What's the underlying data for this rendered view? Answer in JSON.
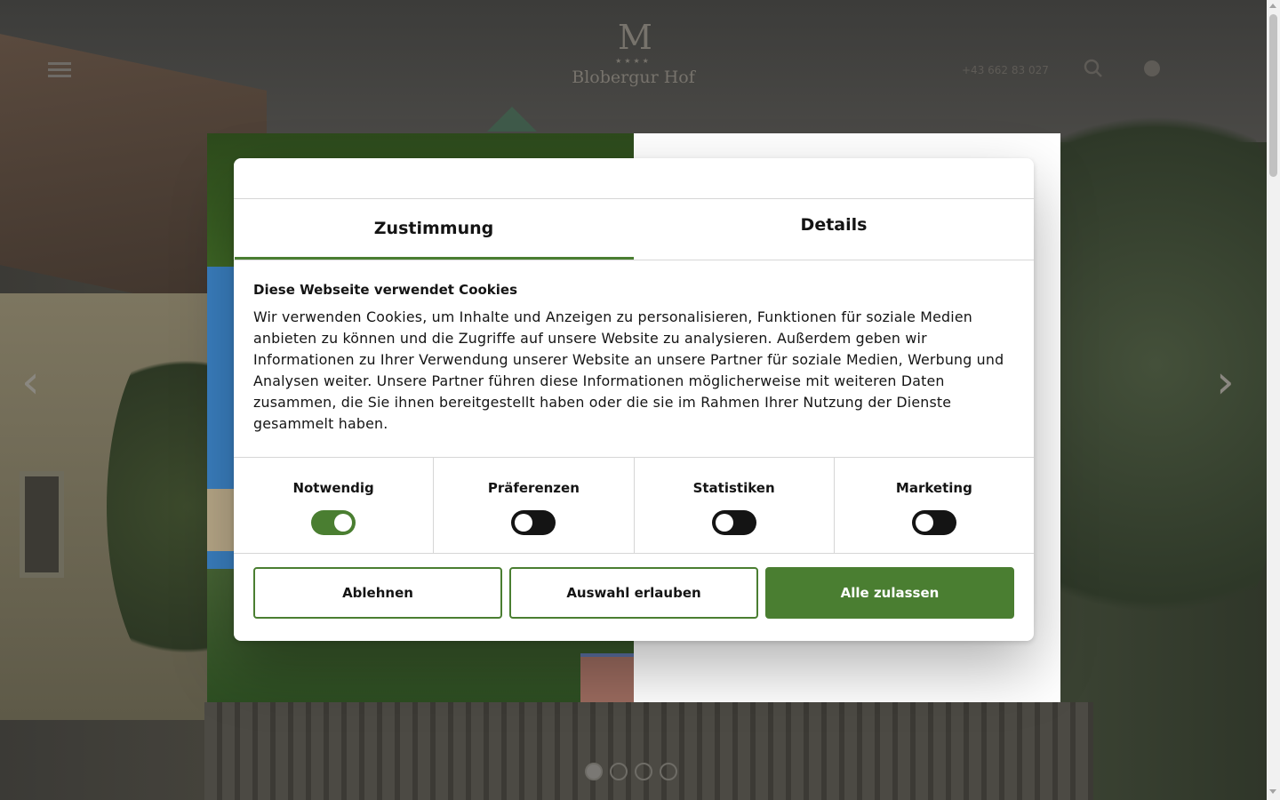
{
  "header": {
    "logo_mark": "M",
    "logo_stars": "★★★★",
    "logo_name": "Blobergur Hof",
    "phone": "+43 662 83 027"
  },
  "icons": {
    "menu": "hamburger-icon",
    "search": "search-icon",
    "language": "globe-icon",
    "prev": "chevron-left-icon",
    "next": "chevron-right-icon"
  },
  "slider": {
    "dot_count": 4,
    "active_dot": 1
  },
  "consent": {
    "tabs": [
      {
        "label": "Zustimmung",
        "active": true
      },
      {
        "label": "Details",
        "active": false
      }
    ],
    "heading": "Diese Webseite verwendet Cookies",
    "text": "Wir verwenden Cookies, um Inhalte und Anzeigen zu personalisieren, Funktionen für soziale Medien anbieten zu können und die Zugriffe auf unsere Website zu analysieren. Außerdem geben wir Informationen zu Ihrer Verwendung unserer Website an unsere Partner für soziale Medien, Werbung und Analysen weiter. Unsere Partner führen diese Informationen möglicherweise mit weiteren Daten zusammen, die Sie ihnen bereitgestellt haben oder die sie im Rahmen Ihrer Nutzung der Dienste gesammelt haben.",
    "categories": [
      {
        "label": "Notwendig",
        "checked": true
      },
      {
        "label": "Präferenzen",
        "checked": false
      },
      {
        "label": "Statistiken",
        "checked": false
      },
      {
        "label": "Marketing",
        "checked": false
      }
    ],
    "buttons": {
      "decline": "Ablehnen",
      "allow_selection": "Auswahl erlauben",
      "allow_all": "Alle zulassen"
    }
  },
  "colors": {
    "accent": "#4a7e31",
    "toggle_off": "#141414",
    "text": "#141414"
  }
}
